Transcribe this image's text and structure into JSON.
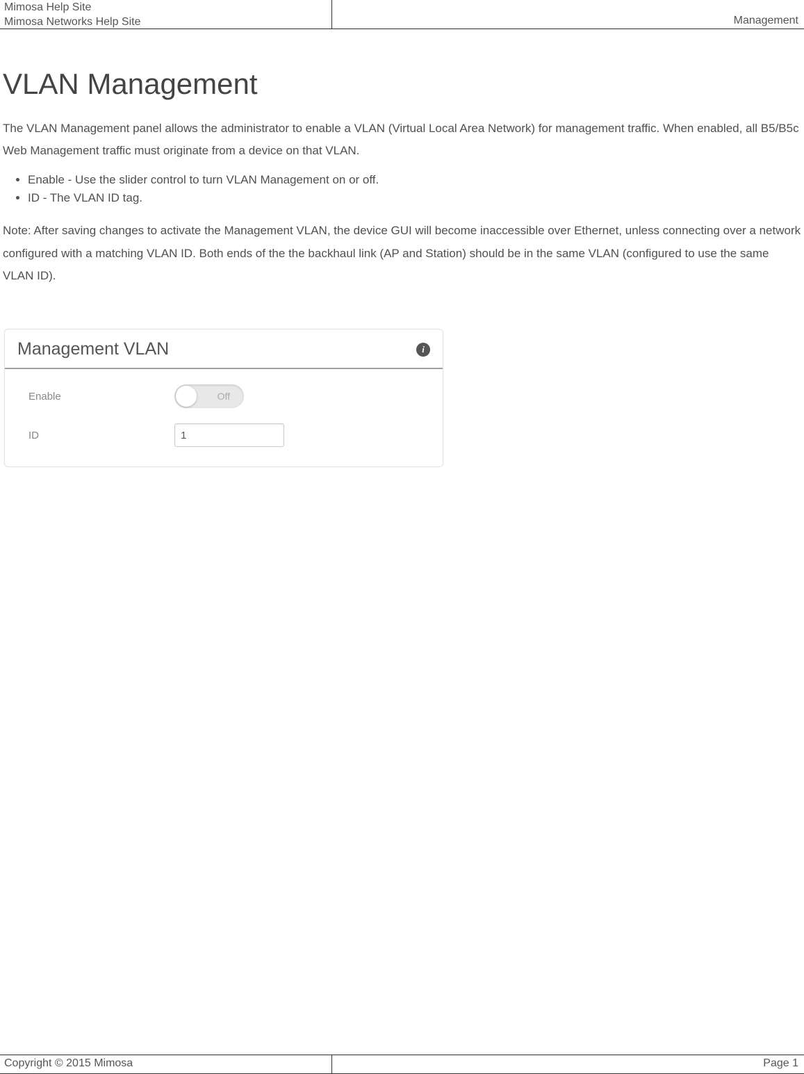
{
  "header": {
    "line1": "Mimosa Help Site",
    "line2": "Mimosa Networks Help Site",
    "right": "Management"
  },
  "title": "VLAN Management",
  "intro": "The VLAN Management panel allows the administrator to enable a VLAN (Virtual Local Area Network) for management traffic. When enabled, all B5/B5c Web Management traffic must originate from a device on that VLAN.",
  "bullets": [
    "Enable - Use the slider control to turn VLAN Management on or off.",
    "ID - The VLAN ID tag."
  ],
  "note": "Note: After saving changes to activate the Management VLAN, the device GUI will become inaccessible over Ethernet, unless connecting over a network configured with a matching VLAN ID. Both ends of the the backhaul link (AP and Station) should be in the same VLAN (configured to use the same VLAN ID).",
  "panel": {
    "title": "Management VLAN",
    "info_icon": "i",
    "enable_label": "Enable",
    "toggle_state": "Off",
    "id_label": "ID",
    "id_value": "1"
  },
  "footer": {
    "left": "Copyright © 2015 Mimosa",
    "right": "Page 1"
  }
}
